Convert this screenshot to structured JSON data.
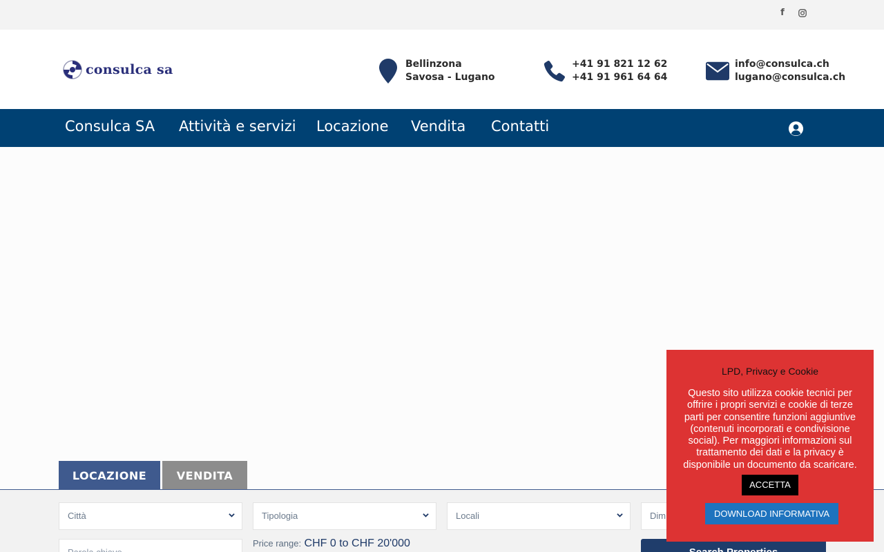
{
  "topbar": {
    "social": [
      {
        "icon": "facebook-icon",
        "glyph": "f"
      },
      {
        "icon": "instagram-icon"
      }
    ]
  },
  "header": {
    "logo_text": "consulca sa",
    "locations": [
      "Bellinzona",
      "Savosa - Lugano"
    ],
    "phones": [
      "+41 91 821 12 62",
      "+41 91 961 64 64"
    ],
    "emails": [
      "info@consulca.ch",
      "lugano@consulca.ch"
    ],
    "brand_color": "#2a2f7a"
  },
  "nav": {
    "items": [
      "Consulca SA",
      "Attività e servizi",
      "Locazione",
      "Vendita",
      "Contatti"
    ],
    "background": "#004173"
  },
  "search": {
    "tabs": [
      "LOCAZIONE",
      "VENDITA"
    ],
    "active_tab": "LOCAZIONE",
    "selects": [
      "Città",
      "Tipologia",
      "Locali",
      "Dim"
    ],
    "keyword_placeholder": "Parola chiave",
    "price_label": "Price range:",
    "price_value": "CHF 0 to CHF 20'000",
    "button_label": "Search Properties"
  },
  "cookie_banner": {
    "title": "LPD, Privacy e Cookie",
    "text": "Questo sito utilizza cookie tecnici per offrire i propri servizi e cookie di terze parti per consentire funzioni aggiuntive (contenuti incorporati e condivisione social). Per maggiori informazioni sul trattamento dei dati e la privacy è disponibile un documento da scaricare.",
    "accept_label": "ACCETTA",
    "download_label": "DOWNLOAD INFORMATIVA",
    "background": "#dd3333"
  }
}
